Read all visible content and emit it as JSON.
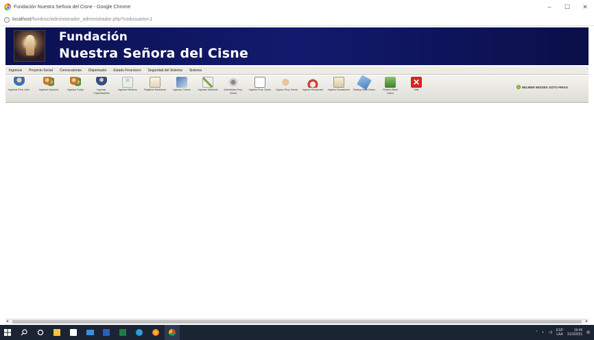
{
  "browser": {
    "tab_title": "Fundación Nuestra Señora del Cisne - Google Chrome",
    "url_host": "localhost",
    "url_path": "/fundnsc/administrador_administrador.php?codusuario=1",
    "min": "–",
    "max": "☐",
    "close": "✕"
  },
  "banner": {
    "line1": "Fundación",
    "line2": "Nuestra Señora del Cisne"
  },
  "menu": [
    "Ingresos",
    "Proyecto Social",
    "Convocatorias",
    "Dispensario",
    "Estado Financiero",
    "Seguridad del Sistema",
    "Sistema"
  ],
  "toolbar": [
    {
      "label": "Ingresar Pers. Adm.",
      "icon": "users-icon"
    },
    {
      "label": "Ingresar Usuarios",
      "icon": "group-icon"
    },
    {
      "label": "Ingresar Social",
      "icon": "group-icon"
    },
    {
      "label": "Ingresar Capacitadores",
      "icon": "person-icon"
    },
    {
      "label": "Ingresar Médicos",
      "icon": "doctor-icon"
    },
    {
      "label": "Registrar Medicinas",
      "icon": "medicine-icon"
    },
    {
      "label": "Ingresar Cursos",
      "icon": "course-icon"
    },
    {
      "label": "Ingresar Matrícula",
      "icon": "enroll-icon"
    },
    {
      "label": "Actividades Proy. Social",
      "icon": "gear-icon"
    },
    {
      "label": "Ingreso Proy. Social",
      "icon": "document-icon"
    },
    {
      "label": "Egreso Proy. Social",
      "icon": "hand-icon"
    },
    {
      "label": "Ingreso Restaurant",
      "icon": "umbrella-icon"
    },
    {
      "label": "Ingreso Donaciones",
      "icon": "paper-icon"
    },
    {
      "label": "Backup Base Datos",
      "icon": "tag-icon"
    },
    {
      "label": "Restore Base Datos",
      "icon": "restore-icon"
    },
    {
      "label": "Salir",
      "icon": "exit-icon"
    }
  ],
  "user": {
    "name": "WILMER MOISES SOTO FRIAS"
  },
  "scroll": {
    "left_arrow": "◂",
    "right_arrow": "▸"
  },
  "tray": {
    "lang_line1": "ESP",
    "lang_line2": "LAA",
    "time": "19:45",
    "date": "31/3/2021"
  }
}
